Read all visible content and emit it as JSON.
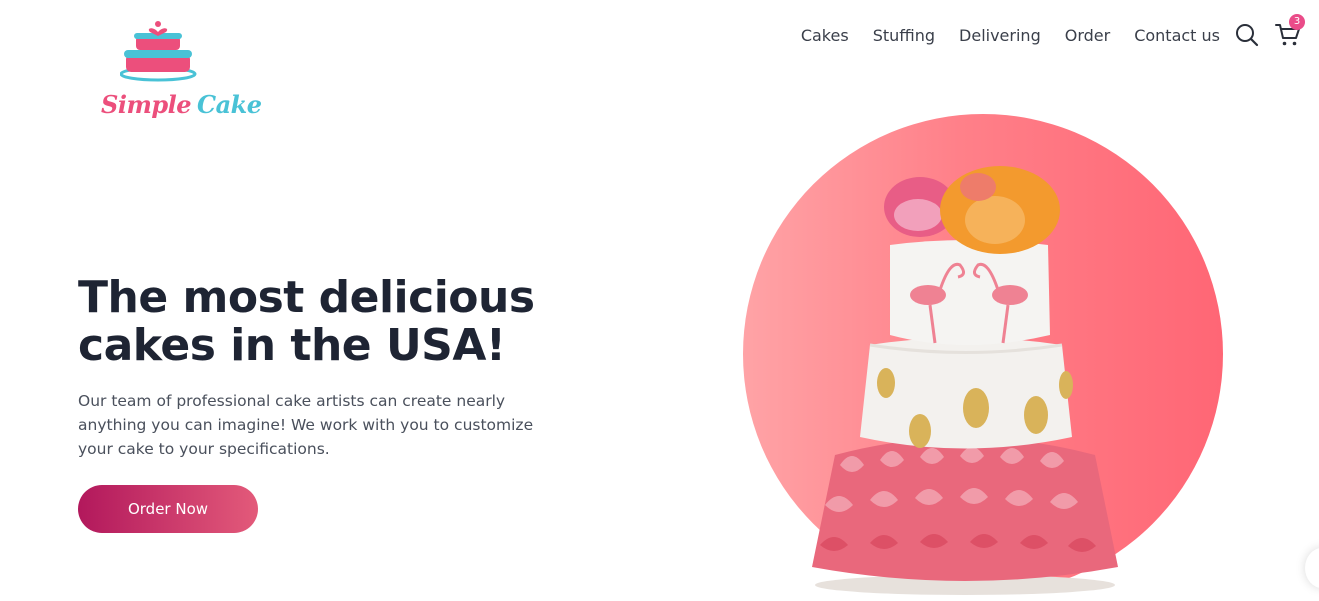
{
  "brand": {
    "logo_word1": "Simple",
    "logo_word2": "Cake",
    "colors": {
      "pink": "#ec4f7c",
      "teal": "#49c2d6"
    }
  },
  "nav": {
    "items": [
      {
        "label": "Cakes"
      },
      {
        "label": "Stuffing"
      },
      {
        "label": "Delivering"
      },
      {
        "label": "Order"
      },
      {
        "label": "Contact us"
      }
    ],
    "search_icon": "search-icon",
    "cart_icon": "cart-icon",
    "cart_count": "3"
  },
  "hero": {
    "title_line1": "The most delicious",
    "title_line2": "cakes in the USA!",
    "description": "Our team of professional cake artists can create nearly anything you can imagine! We work with you to customize your cake to your specifications.",
    "cta_label": "Order Now",
    "accent_colors": {
      "button_start": "#b2185c",
      "button_end": "#e35a7a",
      "circle": "#ff7a84"
    }
  }
}
